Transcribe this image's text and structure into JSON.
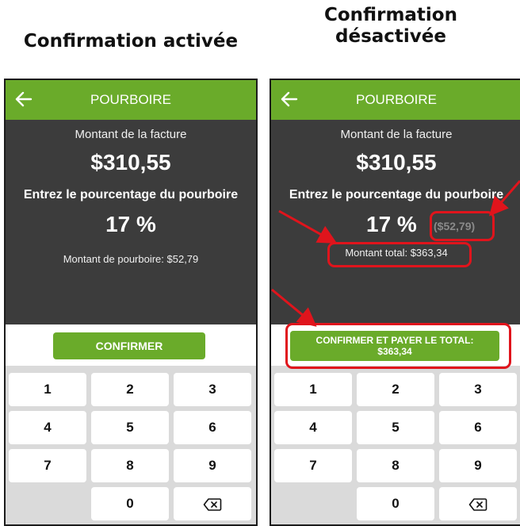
{
  "captions": {
    "left": "Confirmation activée",
    "right_line1": "Confirmation",
    "right_line2": "désactivée"
  },
  "screens": {
    "left": {
      "title": "POURBOIRE",
      "bill_label": "Montant de la facture",
      "bill_amount": "$310,55",
      "prompt": "Entrez le pourcentage du pourboire",
      "percent": "17 %",
      "tip_line": "Montant de pourboire: $52,79",
      "button": "CONFIRMER"
    },
    "right": {
      "title": "POURBOIRE",
      "bill_label": "Montant de la facture",
      "bill_amount": "$310,55",
      "prompt": "Entrez le pourcentage du pourboire",
      "percent": "17 %",
      "tip_grey": "($52,79)",
      "total_line": "Montant total: $363,34",
      "button_line1": "CONFIRMER ET PAYER LE TOTAL:",
      "button_line2": "$363,34"
    }
  },
  "keypad": {
    "keys": [
      "1",
      "2",
      "3",
      "4",
      "5",
      "6",
      "7",
      "8",
      "9",
      "0"
    ],
    "backspace_icon": "backspace-icon"
  },
  "icons": {
    "back": "arrow-left-icon"
  },
  "colors": {
    "accent": "#6aab2a",
    "dark_panel": "#3c3c3c",
    "keypad_bg": "#dadada",
    "highlight": "#e0141c"
  }
}
